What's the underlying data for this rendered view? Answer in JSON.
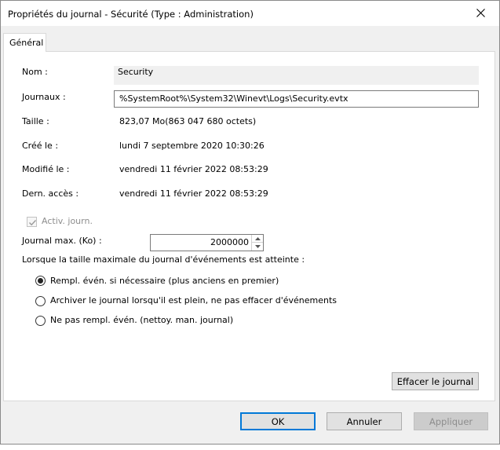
{
  "window": {
    "title": "Propriétés du journal - Sécurité (Type : Administration)"
  },
  "tabs": [
    {
      "label": "Général"
    }
  ],
  "fields": {
    "name_label": "Nom :",
    "name_value": "Security",
    "path_label": "Journaux :",
    "path_value": "%SystemRoot%\\System32\\Winevt\\Logs\\Security.evtx",
    "size_label": "Taille :",
    "size_value": "823,07 Mo(863 047 680 octets)",
    "created_label": "Créé le :",
    "created_value": "lundi 7 septembre 2020 10:30:26",
    "modified_label": "Modifié le :",
    "modified_value": "vendredi 11 février 2022 08:53:29",
    "accessed_label": "Dern. accès :",
    "accessed_value": "vendredi 11 février 2022 08:53:29"
  },
  "logging": {
    "enable_label": "Activ. journ.",
    "enabled": true,
    "max_size_label": "Journal max. (Ko) :",
    "max_size_value": "2000000",
    "policy_label": "Lorsque la taille maximale du journal d'événements est atteinte :",
    "options": [
      {
        "label": "Rempl. évén. si nécessaire (plus anciens en premier)",
        "checked": true
      },
      {
        "label": "Archiver le journal lorsqu'il est plein, ne pas effacer d'événements",
        "checked": false
      },
      {
        "label": "Ne pas rempl. évén. (nettoy. man. journal)",
        "checked": false
      }
    ]
  },
  "buttons": {
    "clear_log": "Effacer le journal",
    "ok": "OK",
    "cancel": "Annuler",
    "apply": "Appliquer"
  },
  "colors": {
    "accent": "#0078d7",
    "dialog_bg": "#f0f0f0",
    "panel_bg": "#ffffff"
  }
}
